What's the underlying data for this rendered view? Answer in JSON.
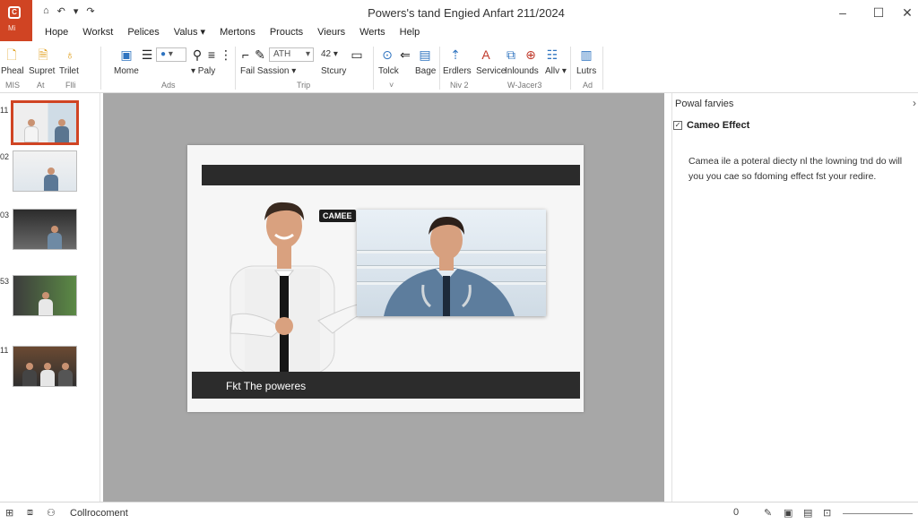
{
  "app": {
    "logo_sub": "Mi"
  },
  "window": {
    "title": "Powers's tand Engied Anfart 211/2024"
  },
  "quick_access": {
    "home_glyph": "⌂",
    "undo_glyph": "↶",
    "dropdown_glyph": "▾",
    "redo_glyph": "↷"
  },
  "menu": {
    "tabs": [
      "Hope",
      "Workst",
      "Pelices",
      "Valus ▾",
      "Mertons",
      "Proucts",
      "Vieurs",
      "Werts",
      "Help"
    ]
  },
  "ribbon": {
    "group1": {
      "items": [
        "Pheal",
        "Supret",
        "Trilet"
      ],
      "sub": [
        "MIS",
        "At",
        "Flli"
      ]
    },
    "group2": {
      "label_mome": "Mome",
      "label_paly": "▾ Paly",
      "footer": "Ads"
    },
    "group3": {
      "field_value": "ATH",
      "size_value": "42",
      "label_session": "Fail Sassion ▾",
      "label_stcury": "Stcury",
      "footer": "Trip"
    },
    "group4": {
      "items": [
        "Tolck",
        "Bage"
      ],
      "footer": "˅"
    },
    "group5": {
      "items": [
        "Erdlers",
        "Service",
        "Inlounds",
        "Allv ▾"
      ],
      "footer": [
        "Niv  2",
        "W-Jacer3"
      ]
    },
    "group6": {
      "items": [
        "Lutrs"
      ],
      "footer": "Ad"
    }
  },
  "thumbnails": {
    "numbers": [
      "11",
      "02",
      "03",
      "53",
      "11"
    ]
  },
  "slide": {
    "cameo_tag": "CAMEE",
    "caption": "Fkt The poweres"
  },
  "right_pane": {
    "title": "Powal farvies",
    "check_label": "Cameo Effect",
    "description": "Camea ile a poteral diecty nl the lowning tnd do will you you cae so fdoming effect fst your redire."
  },
  "status": {
    "text": "Collrocoment",
    "left_value": "0"
  },
  "colors": {
    "accent": "#d04423",
    "canvas_bg": "#a7a7a7",
    "slide_bar": "#2b2b2b"
  }
}
